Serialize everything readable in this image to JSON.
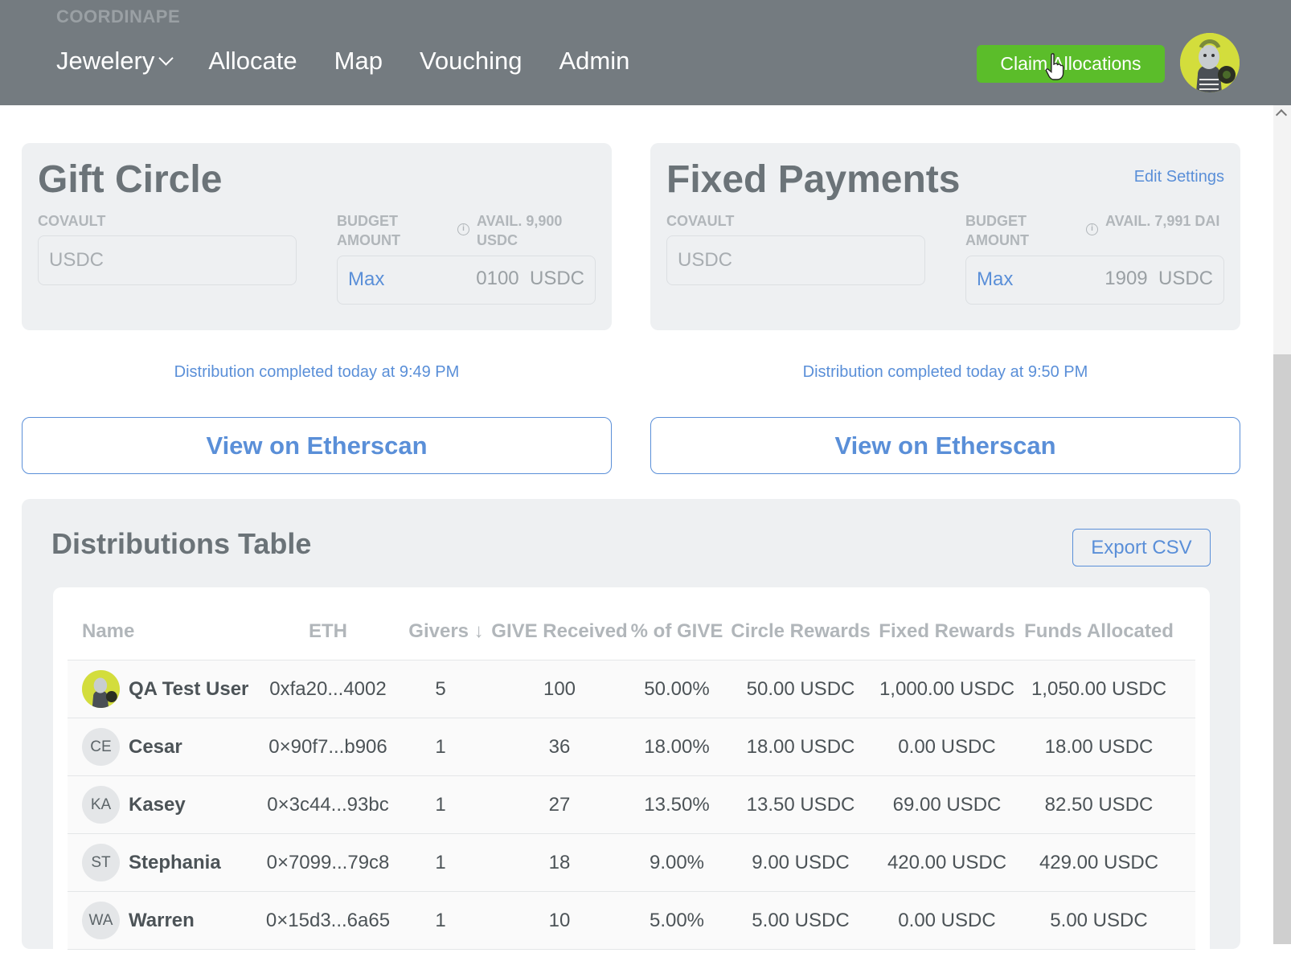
{
  "header": {
    "brand": "COORDINAPE",
    "nav": [
      {
        "label": "Jewelery",
        "has_dropdown": true
      },
      {
        "label": "Allocate"
      },
      {
        "label": "Map"
      },
      {
        "label": "Vouching"
      },
      {
        "label": "Admin"
      }
    ],
    "claim_button": "Claim Allocations",
    "colors": {
      "bar": "#747b80",
      "claim": "#5bbd2a"
    }
  },
  "gift_circle": {
    "title": "Gift Circle",
    "covault_label": "COVAULT",
    "covault_value": "USDC",
    "budget_label": "BUDGET AMOUNT",
    "avail": "AVAIL. 9,900 USDC",
    "max_label": "Max",
    "amount": "0100",
    "unit": "USDC",
    "status": "Distribution completed today at 9:49 PM",
    "etherscan": "View on Etherscan"
  },
  "fixed_payments": {
    "title": "Fixed Payments",
    "edit_settings": "Edit Settings",
    "covault_label": "COVAULT",
    "covault_value": "USDC",
    "budget_label": "BUDGET AMOUNT",
    "avail": "AVAIL. 7,991 DAI",
    "max_label": "Max",
    "amount": "1909",
    "unit": "USDC",
    "status": "Distribution completed today at 9:50 PM",
    "etherscan": "View on Etherscan"
  },
  "distributions": {
    "title": "Distributions Table",
    "export_label": "Export CSV",
    "columns": [
      "Name",
      "ETH",
      "Givers ↓",
      "GIVE Received",
      "% of GIVE",
      "Circle Rewards",
      "Fixed Rewards",
      "Funds Allocated"
    ],
    "rows": [
      {
        "initials": "",
        "avatar_image": true,
        "name": "QA Test User",
        "eth": "0xfa20...4002",
        "givers": "5",
        "give": "100",
        "pct": "50.00%",
        "circle": "50.00 USDC",
        "fixed": "1,000.00 USDC",
        "funds": "1,050.00 USDC"
      },
      {
        "initials": "CE",
        "name": "Cesar",
        "eth": "0×90f7...b906",
        "givers": "1",
        "give": "36",
        "pct": "18.00%",
        "circle": "18.00 USDC",
        "fixed": "0.00 USDC",
        "funds": "18.00 USDC"
      },
      {
        "initials": "KA",
        "name": "Kasey",
        "eth": "0×3c44...93bc",
        "givers": "1",
        "give": "27",
        "pct": "13.50%",
        "circle": "13.50 USDC",
        "fixed": "69.00 USDC",
        "funds": "82.50 USDC"
      },
      {
        "initials": "ST",
        "name": "Stephania",
        "eth": "0×7099...79c8",
        "givers": "1",
        "give": "18",
        "pct": "9.00%",
        "circle": "9.00 USDC",
        "fixed": "420.00 USDC",
        "funds": "429.00 USDC"
      },
      {
        "initials": "WA",
        "name": "Warren",
        "eth": "0×15d3...6a65",
        "givers": "1",
        "give": "10",
        "pct": "5.00%",
        "circle": "5.00 USDC",
        "fixed": "0.00 USDC",
        "funds": "5.00 USDC"
      }
    ]
  }
}
